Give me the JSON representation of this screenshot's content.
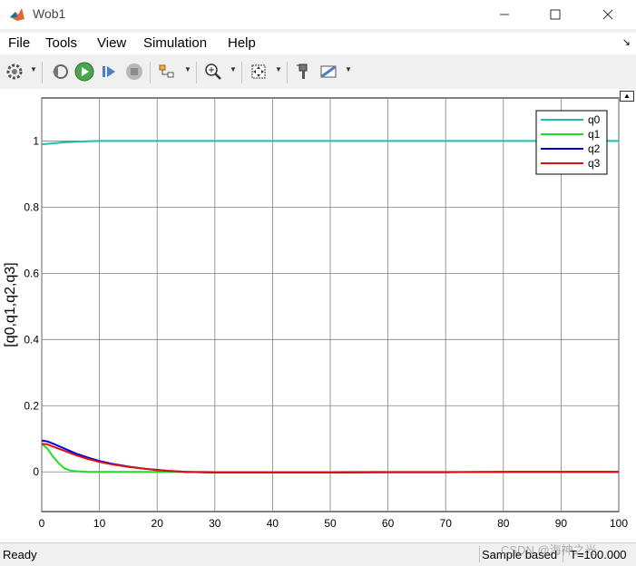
{
  "window": {
    "title": "Wob1"
  },
  "menu": {
    "items": [
      "File",
      "Tools",
      "View",
      "Simulation",
      "Help"
    ]
  },
  "toolbar": {
    "icons": [
      "settings-icon",
      "step-back-icon",
      "run-icon",
      "step-forward-icon",
      "stop-icon",
      "signal-select-icon",
      "zoom-icon",
      "fit-view-icon",
      "style-icon",
      "measure-icon"
    ]
  },
  "status": {
    "ready": "Ready",
    "sample": "Sample based",
    "time": "T=100.000"
  },
  "watermark": "CSDN @海神之光",
  "chart_data": {
    "type": "line",
    "title": "",
    "xlabel": "",
    "ylabel": "[q0,q1,q2,q3]",
    "xlim": [
      0,
      100
    ],
    "ylim": [
      -0.12,
      1.13
    ],
    "xticks": [
      0,
      10,
      20,
      30,
      40,
      50,
      60,
      70,
      80,
      90,
      100
    ],
    "yticks": [
      0,
      0.2,
      0.4,
      0.6,
      0.8,
      1
    ],
    "grid": true,
    "legend_position": "top-right",
    "series": [
      {
        "name": "q0",
        "color": "#1fbcb0",
        "x": [
          0,
          2,
          4,
          6,
          8,
          10,
          15,
          20,
          30,
          40,
          50,
          60,
          70,
          80,
          90,
          100
        ],
        "y": [
          0.99,
          0.993,
          0.996,
          0.998,
          0.999,
          1.0,
          1.0,
          1.0,
          1.0,
          1.0,
          1.0,
          1.0,
          1.0,
          1.0,
          1.0,
          1.0
        ]
      },
      {
        "name": "q1",
        "color": "#22dd22",
        "x": [
          0,
          1,
          2,
          3,
          4,
          5,
          6,
          8,
          10,
          15,
          20,
          30,
          40,
          50,
          60,
          70,
          80,
          90,
          100
        ],
        "y": [
          0.085,
          0.07,
          0.045,
          0.025,
          0.01,
          0.004,
          0.002,
          0.0,
          0.0,
          0.0,
          0.0,
          0.0,
          0.0,
          0.0,
          0.0,
          0.0,
          0.0,
          0.0,
          0.0
        ]
      },
      {
        "name": "q2",
        "color": "#0000dd",
        "x": [
          0,
          1,
          2,
          4,
          6,
          8,
          10,
          12,
          15,
          18,
          20,
          22,
          25,
          30,
          40,
          50,
          60,
          70,
          80,
          90,
          100
        ],
        "y": [
          0.095,
          0.092,
          0.085,
          0.07,
          0.055,
          0.043,
          0.033,
          0.025,
          0.016,
          0.009,
          0.006,
          0.003,
          0.0,
          -0.002,
          -0.002,
          -0.002,
          -0.001,
          -0.001,
          0.0,
          0.0,
          0.0
        ]
      },
      {
        "name": "q3",
        "color": "#dd1111",
        "x": [
          0,
          1,
          2,
          4,
          6,
          8,
          10,
          12,
          15,
          18,
          20,
          22,
          25,
          30,
          40,
          50,
          60,
          70,
          80,
          90,
          100
        ],
        "y": [
          0.085,
          0.083,
          0.076,
          0.063,
          0.05,
          0.039,
          0.03,
          0.023,
          0.015,
          0.009,
          0.005,
          0.003,
          0.0,
          -0.002,
          -0.002,
          -0.002,
          -0.001,
          -0.001,
          0.0,
          0.0,
          0.0
        ]
      }
    ]
  }
}
